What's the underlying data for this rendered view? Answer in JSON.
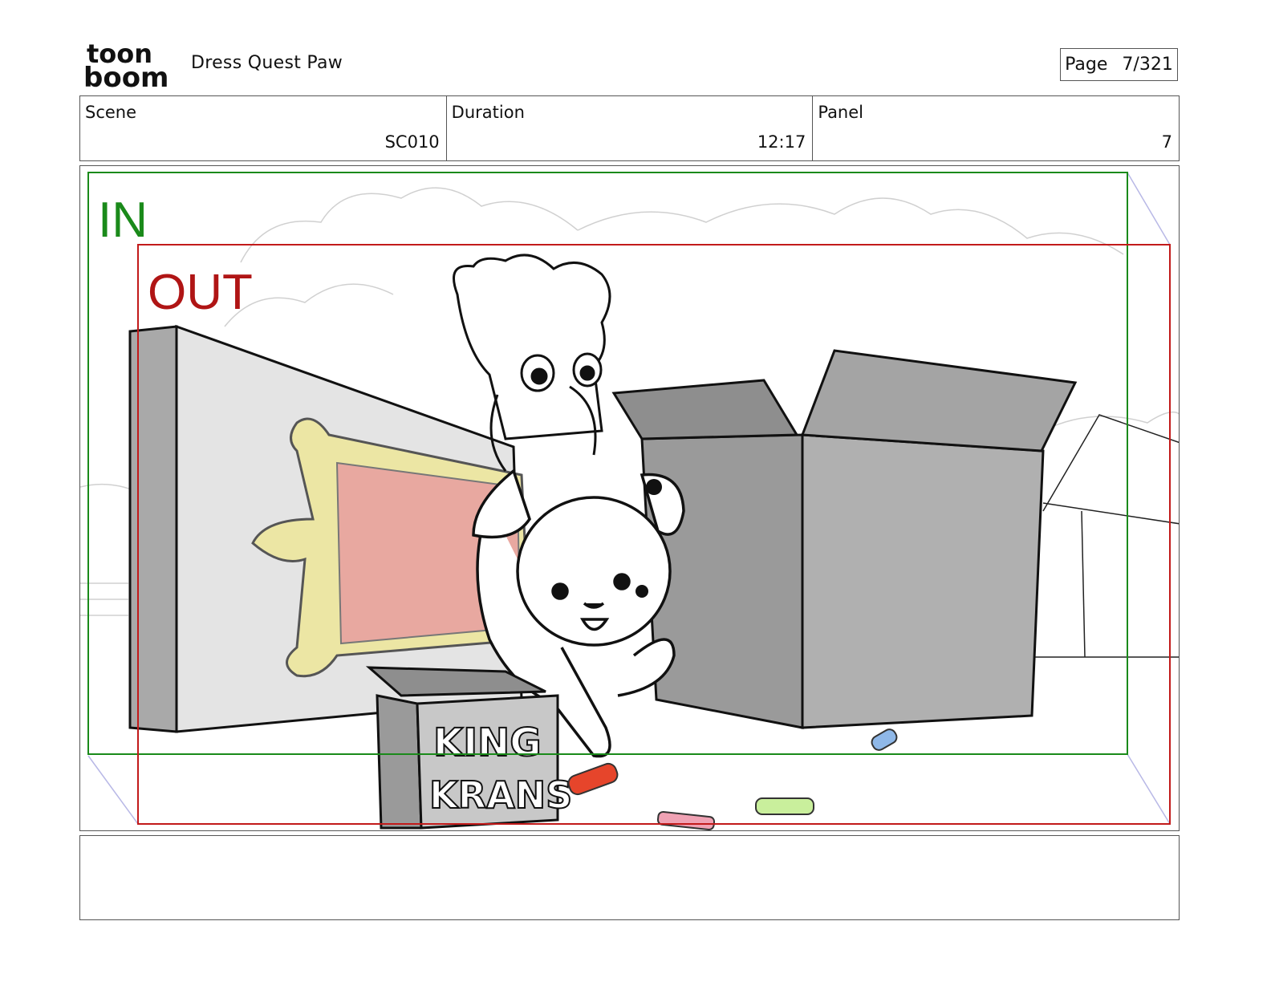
{
  "header": {
    "logo_text_top": "toon",
    "logo_text_bottom": "boom",
    "project_title": "Dress Quest Paw",
    "page_label": "Page",
    "page_value": "7/321"
  },
  "info": {
    "scene_label": "Scene",
    "scene_value": "SC010",
    "duration_label": "Duration",
    "duration_value": "12:17",
    "panel_label": "Panel",
    "panel_value": "7"
  },
  "panel": {
    "in_label": "IN",
    "out_label": "OUT",
    "box_text_line1": "KING",
    "box_text_line2": "KRANS",
    "colors": {
      "in_frame": "#1a8a1a",
      "out_frame": "#c21a1a",
      "box_gray": "#a9a9a9",
      "mirror_pink": "#e8a8a0",
      "frame_yellow": "#e6dc8c",
      "crayon_red": "#e6452b",
      "crayon_green": "#c9ef9c",
      "crayon_pink": "#f0a2b4",
      "crayon_blue": "#8fb8e8"
    }
  },
  "notes": {
    "text": ""
  }
}
